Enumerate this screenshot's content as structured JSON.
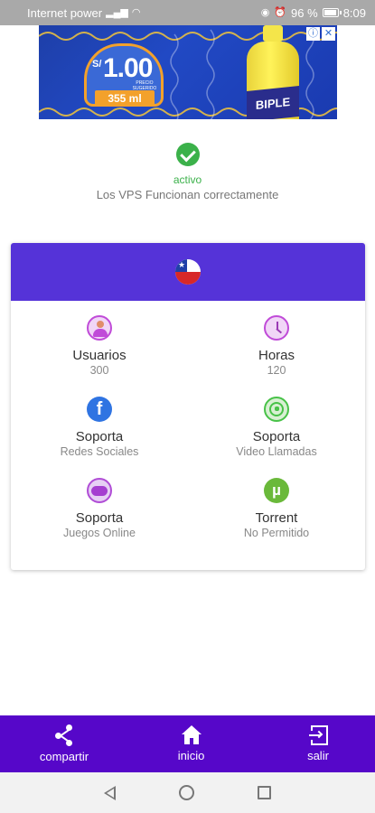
{
  "statusbar": {
    "carrier": "Internet power",
    "battery": "96 %",
    "battery_level": 0.96,
    "time": "8:09"
  },
  "ad": {
    "currency": "S/",
    "price": "1.00",
    "price_note": "PRECIO SUGERIDO",
    "volume": "355 ml",
    "product_label": "BIPLE",
    "colors": {
      "background": "#2149c4",
      "accent": "#f3a12b",
      "bottle": "#fff35a"
    }
  },
  "status": {
    "state": "activo",
    "description": "Los VPS Funcionan correctamente",
    "color": "#3bb14a"
  },
  "card": {
    "header_color": "#5533d8",
    "flag": "chile-flag-icon",
    "features": [
      {
        "icon": "user-icon",
        "title": "Usuarios",
        "sub": "300"
      },
      {
        "icon": "clock-icon",
        "title": "Horas",
        "sub": "120"
      },
      {
        "icon": "facebook-icon",
        "title": "Soporta",
        "sub": "Redes Sociales",
        "glyph": "f"
      },
      {
        "icon": "whatsapp-icon",
        "title": "Soporta",
        "sub": "Video Llamadas"
      },
      {
        "icon": "gamepad-icon",
        "title": "Soporta",
        "sub": "Juegos Online"
      },
      {
        "icon": "utorrent-icon",
        "title": "Torrent",
        "sub": "No Permitido",
        "glyph": "µ"
      }
    ]
  },
  "bottomnav": {
    "color": "#5607c9",
    "items": [
      {
        "icon": "share-icon",
        "label": "compartir"
      },
      {
        "icon": "home-icon",
        "label": "inicio"
      },
      {
        "icon": "exit-icon",
        "label": "salir"
      }
    ]
  }
}
